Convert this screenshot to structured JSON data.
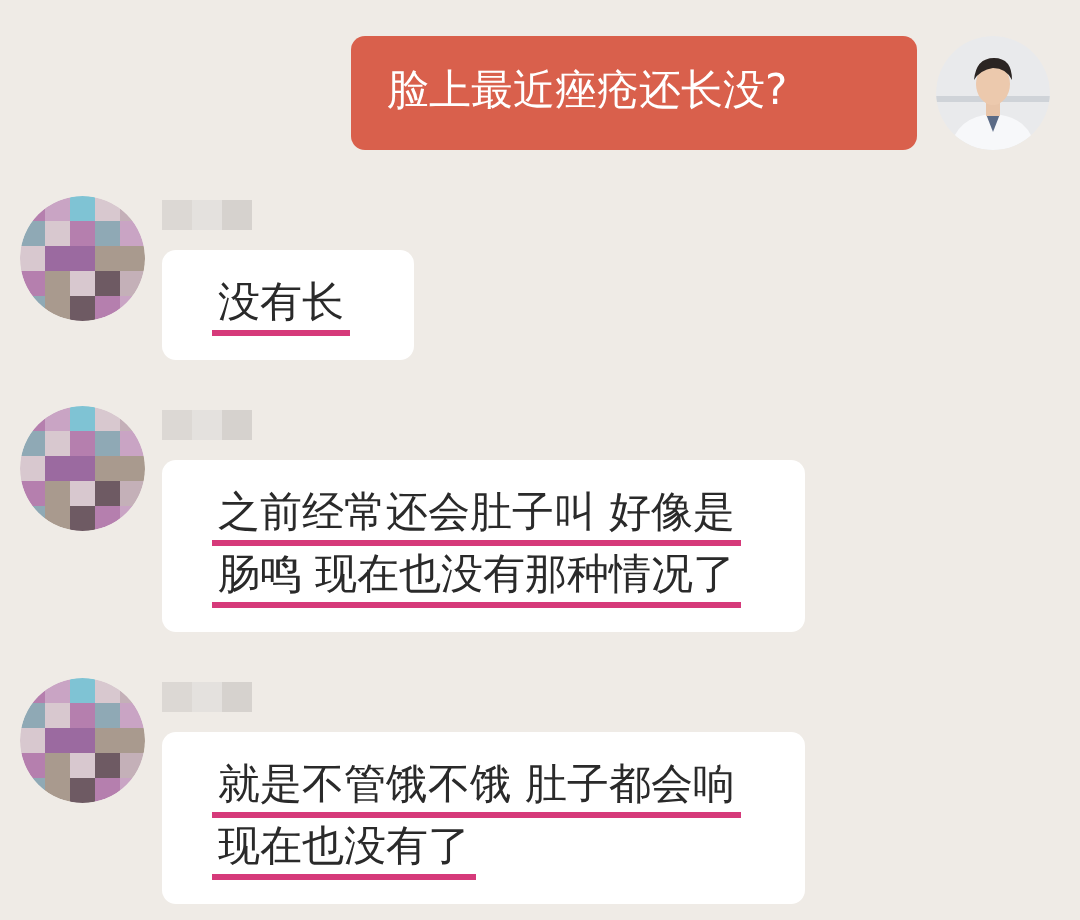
{
  "messages": [
    {
      "kind": "outgoing",
      "lines": [
        {
          "text": "脸上最近痤疮还长没?",
          "underlined": false
        }
      ]
    },
    {
      "kind": "incoming",
      "lines": [
        {
          "text": "没有长",
          "underlined": true
        }
      ]
    },
    {
      "kind": "incoming",
      "lines": [
        {
          "text": "之前经常还会肚子叫 好像是",
          "underlined": true
        },
        {
          "text": "肠鸣 现在也没有那种情况了",
          "underlined": true
        }
      ]
    },
    {
      "kind": "incoming",
      "lines": [
        {
          "text": "就是不管饿不饿 肚子都会响",
          "underlined": true
        },
        {
          "text": "现在也没有了",
          "underlined": true
        }
      ]
    }
  ]
}
